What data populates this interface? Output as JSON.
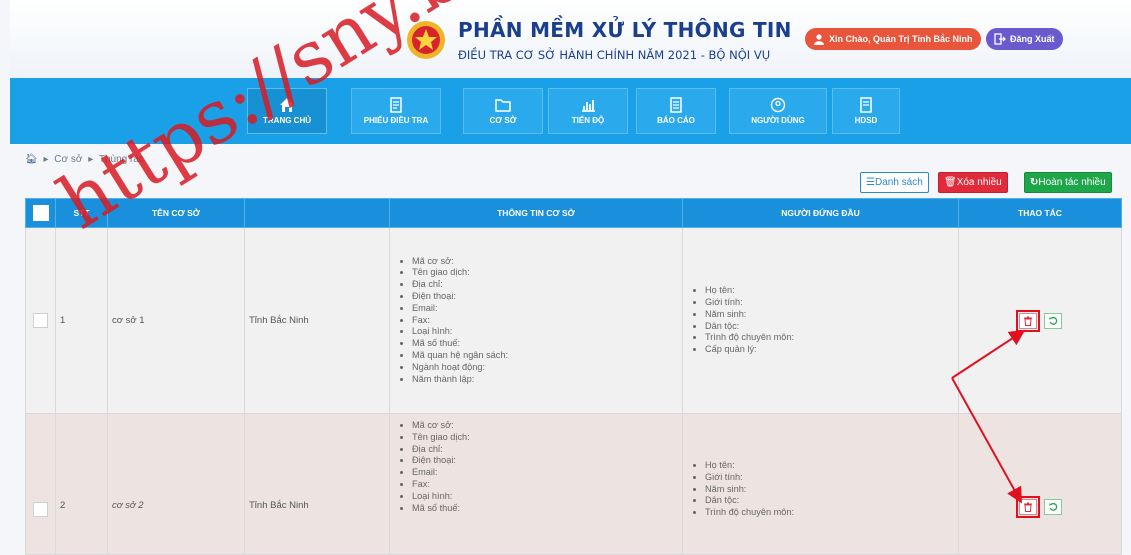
{
  "header": {
    "title": "PHẦN MỀM XỬ LÝ THÔNG TIN",
    "subtitle": "ĐIỀU TRA CƠ SỞ HÀNH CHÍNH NĂM 2021 - BỘ NỘI VỤ",
    "greeting": "Xin Chào, Quản Trị Tỉnh Bắc Ninh",
    "logout": "Đăng Xuất"
  },
  "nav": [
    {
      "label": "TRANG CHỦ",
      "icon": "home-icon"
    },
    {
      "label": "PHIẾU ĐIỀU TRA",
      "icon": "document-icon"
    },
    {
      "label": "CƠ SỞ",
      "icon": "folder-icon"
    },
    {
      "label": "TIẾN ĐỘ",
      "icon": "chart-icon"
    },
    {
      "label": "BÁO CÁO",
      "icon": "report-icon"
    },
    {
      "label": "NGƯỜI DÙNG",
      "icon": "user-icon"
    },
    {
      "label": "HDSD",
      "icon": "manual-icon"
    }
  ],
  "breadcrumb": {
    "level1": "Cơ sở",
    "level2": "Thùng rác"
  },
  "actions": {
    "list": "Danh sách",
    "delete_many": "Xóa nhiều",
    "undo_many": "Hoàn tác nhiều"
  },
  "table": {
    "headers": [
      "STT",
      "TÊN CƠ SỞ",
      "",
      "THÔNG TIN CƠ SỞ",
      "NGƯỜI ĐỨNG ĐẦU",
      "THAO TÁC"
    ],
    "rows": [
      {
        "stt": "1",
        "name": "cơ sở 1",
        "province": "Tỉnh Bắc Ninh",
        "info": [
          "Mã cơ sở:",
          "Tên giao dịch:",
          "Địa chỉ:",
          "Điện thoại:",
          "Email:",
          "Fax:",
          "Loại hình:",
          "Mã số thuế:",
          "Mã quan hệ ngân sách:",
          "Ngành hoạt động:",
          "Năm thành lập:"
        ],
        "head": [
          "Họ tên:",
          "Giới tính:",
          "Năm sinh:",
          "Dân tộc:",
          "Trình độ chuyên môn:",
          "Cấp quản lý:"
        ]
      },
      {
        "stt": "2",
        "name": "cơ sở 2",
        "province": "Tỉnh Bắc Ninh",
        "info": [
          "Mã cơ sở:",
          "Tên giao dịch:",
          "Địa chỉ:",
          "Điện thoại:",
          "Email:",
          "Fax:",
          "Loại hình:",
          "Mã số thuế:"
        ],
        "head": [
          "Họ tên:",
          "Giới tính:",
          "Năm sinh:",
          "Dân tộc:",
          "Trình độ chuyên môn:"
        ]
      }
    ]
  },
  "watermark": "https://sny.bd",
  "colors": {
    "nav": "#1aa0e6",
    "header_th": "#1a8fdc",
    "danger": "#e02b3c",
    "success": "#1ea64a",
    "highlight": "#e01020"
  }
}
